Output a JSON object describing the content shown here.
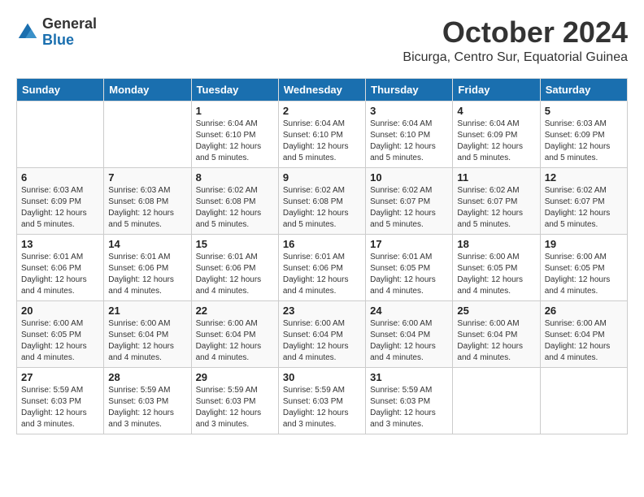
{
  "header": {
    "logo_general": "General",
    "logo_blue": "Blue",
    "month": "October 2024",
    "location": "Bicurga, Centro Sur, Equatorial Guinea"
  },
  "weekdays": [
    "Sunday",
    "Monday",
    "Tuesday",
    "Wednesday",
    "Thursday",
    "Friday",
    "Saturday"
  ],
  "weeks": [
    [
      null,
      null,
      {
        "day": "1",
        "sunrise": "Sunrise: 6:04 AM",
        "sunset": "Sunset: 6:10 PM",
        "daylight": "Daylight: 12 hours and 5 minutes."
      },
      {
        "day": "2",
        "sunrise": "Sunrise: 6:04 AM",
        "sunset": "Sunset: 6:10 PM",
        "daylight": "Daylight: 12 hours and 5 minutes."
      },
      {
        "day": "3",
        "sunrise": "Sunrise: 6:04 AM",
        "sunset": "Sunset: 6:10 PM",
        "daylight": "Daylight: 12 hours and 5 minutes."
      },
      {
        "day": "4",
        "sunrise": "Sunrise: 6:04 AM",
        "sunset": "Sunset: 6:09 PM",
        "daylight": "Daylight: 12 hours and 5 minutes."
      },
      {
        "day": "5",
        "sunrise": "Sunrise: 6:03 AM",
        "sunset": "Sunset: 6:09 PM",
        "daylight": "Daylight: 12 hours and 5 minutes."
      }
    ],
    [
      {
        "day": "6",
        "sunrise": "Sunrise: 6:03 AM",
        "sunset": "Sunset: 6:09 PM",
        "daylight": "Daylight: 12 hours and 5 minutes."
      },
      {
        "day": "7",
        "sunrise": "Sunrise: 6:03 AM",
        "sunset": "Sunset: 6:08 PM",
        "daylight": "Daylight: 12 hours and 5 minutes."
      },
      {
        "day": "8",
        "sunrise": "Sunrise: 6:02 AM",
        "sunset": "Sunset: 6:08 PM",
        "daylight": "Daylight: 12 hours and 5 minutes."
      },
      {
        "day": "9",
        "sunrise": "Sunrise: 6:02 AM",
        "sunset": "Sunset: 6:08 PM",
        "daylight": "Daylight: 12 hours and 5 minutes."
      },
      {
        "day": "10",
        "sunrise": "Sunrise: 6:02 AM",
        "sunset": "Sunset: 6:07 PM",
        "daylight": "Daylight: 12 hours and 5 minutes."
      },
      {
        "day": "11",
        "sunrise": "Sunrise: 6:02 AM",
        "sunset": "Sunset: 6:07 PM",
        "daylight": "Daylight: 12 hours and 5 minutes."
      },
      {
        "day": "12",
        "sunrise": "Sunrise: 6:02 AM",
        "sunset": "Sunset: 6:07 PM",
        "daylight": "Daylight: 12 hours and 5 minutes."
      }
    ],
    [
      {
        "day": "13",
        "sunrise": "Sunrise: 6:01 AM",
        "sunset": "Sunset: 6:06 PM",
        "daylight": "Daylight: 12 hours and 4 minutes."
      },
      {
        "day": "14",
        "sunrise": "Sunrise: 6:01 AM",
        "sunset": "Sunset: 6:06 PM",
        "daylight": "Daylight: 12 hours and 4 minutes."
      },
      {
        "day": "15",
        "sunrise": "Sunrise: 6:01 AM",
        "sunset": "Sunset: 6:06 PM",
        "daylight": "Daylight: 12 hours and 4 minutes."
      },
      {
        "day": "16",
        "sunrise": "Sunrise: 6:01 AM",
        "sunset": "Sunset: 6:06 PM",
        "daylight": "Daylight: 12 hours and 4 minutes."
      },
      {
        "day": "17",
        "sunrise": "Sunrise: 6:01 AM",
        "sunset": "Sunset: 6:05 PM",
        "daylight": "Daylight: 12 hours and 4 minutes."
      },
      {
        "day": "18",
        "sunrise": "Sunrise: 6:00 AM",
        "sunset": "Sunset: 6:05 PM",
        "daylight": "Daylight: 12 hours and 4 minutes."
      },
      {
        "day": "19",
        "sunrise": "Sunrise: 6:00 AM",
        "sunset": "Sunset: 6:05 PM",
        "daylight": "Daylight: 12 hours and 4 minutes."
      }
    ],
    [
      {
        "day": "20",
        "sunrise": "Sunrise: 6:00 AM",
        "sunset": "Sunset: 6:05 PM",
        "daylight": "Daylight: 12 hours and 4 minutes."
      },
      {
        "day": "21",
        "sunrise": "Sunrise: 6:00 AM",
        "sunset": "Sunset: 6:04 PM",
        "daylight": "Daylight: 12 hours and 4 minutes."
      },
      {
        "day": "22",
        "sunrise": "Sunrise: 6:00 AM",
        "sunset": "Sunset: 6:04 PM",
        "daylight": "Daylight: 12 hours and 4 minutes."
      },
      {
        "day": "23",
        "sunrise": "Sunrise: 6:00 AM",
        "sunset": "Sunset: 6:04 PM",
        "daylight": "Daylight: 12 hours and 4 minutes."
      },
      {
        "day": "24",
        "sunrise": "Sunrise: 6:00 AM",
        "sunset": "Sunset: 6:04 PM",
        "daylight": "Daylight: 12 hours and 4 minutes."
      },
      {
        "day": "25",
        "sunrise": "Sunrise: 6:00 AM",
        "sunset": "Sunset: 6:04 PM",
        "daylight": "Daylight: 12 hours and 4 minutes."
      },
      {
        "day": "26",
        "sunrise": "Sunrise: 6:00 AM",
        "sunset": "Sunset: 6:04 PM",
        "daylight": "Daylight: 12 hours and 4 minutes."
      }
    ],
    [
      {
        "day": "27",
        "sunrise": "Sunrise: 5:59 AM",
        "sunset": "Sunset: 6:03 PM",
        "daylight": "Daylight: 12 hours and 3 minutes."
      },
      {
        "day": "28",
        "sunrise": "Sunrise: 5:59 AM",
        "sunset": "Sunset: 6:03 PM",
        "daylight": "Daylight: 12 hours and 3 minutes."
      },
      {
        "day": "29",
        "sunrise": "Sunrise: 5:59 AM",
        "sunset": "Sunset: 6:03 PM",
        "daylight": "Daylight: 12 hours and 3 minutes."
      },
      {
        "day": "30",
        "sunrise": "Sunrise: 5:59 AM",
        "sunset": "Sunset: 6:03 PM",
        "daylight": "Daylight: 12 hours and 3 minutes."
      },
      {
        "day": "31",
        "sunrise": "Sunrise: 5:59 AM",
        "sunset": "Sunset: 6:03 PM",
        "daylight": "Daylight: 12 hours and 3 minutes."
      },
      null,
      null
    ]
  ]
}
